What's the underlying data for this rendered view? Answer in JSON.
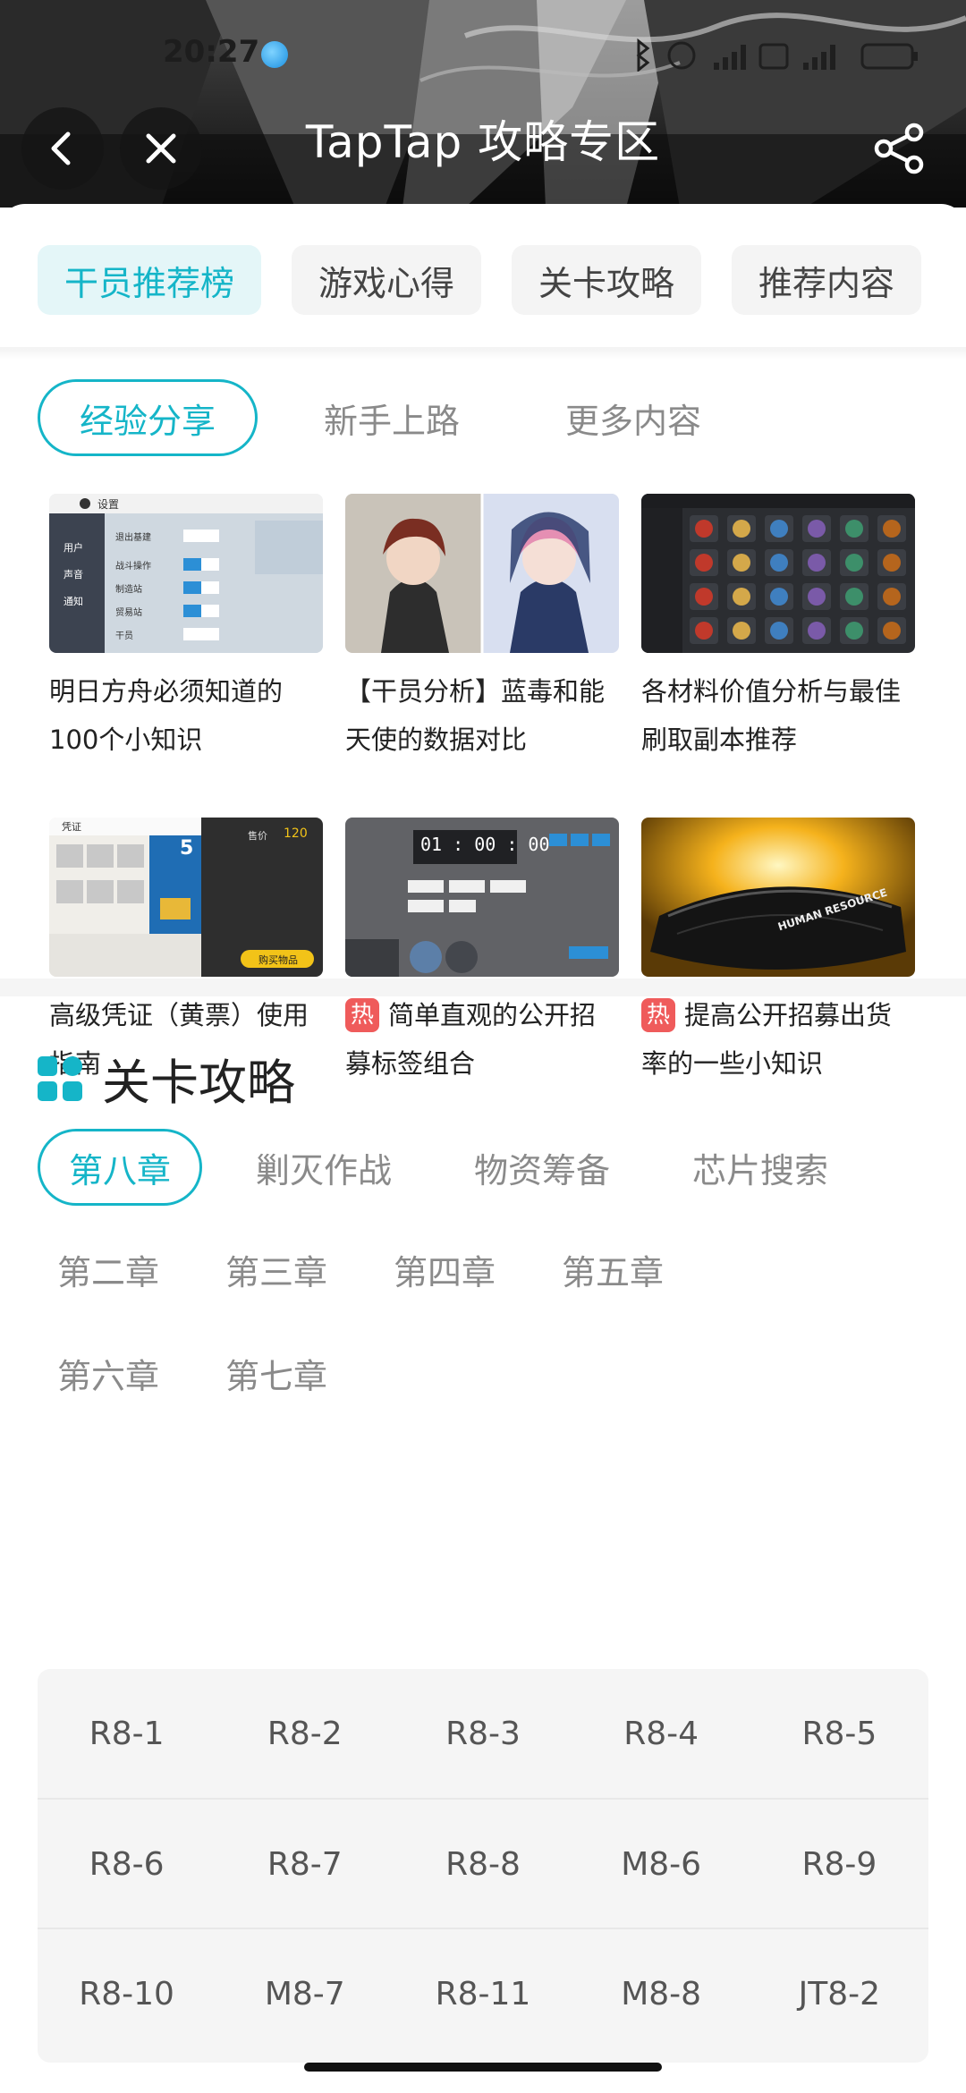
{
  "status_bar": {
    "time": "20:27"
  },
  "header": {
    "title": "TapTap 攻略专区"
  },
  "top_tabs": [
    {
      "label": "干员推荐榜",
      "active": true
    },
    {
      "label": "游戏心得",
      "active": false
    },
    {
      "label": "关卡攻略",
      "active": false
    },
    {
      "label": "推荐内容",
      "active": false
    }
  ],
  "sub_tabs": [
    {
      "label": "经验分享",
      "active": true
    },
    {
      "label": "新手上路",
      "active": false
    },
    {
      "label": "更多内容",
      "active": false
    }
  ],
  "articles": [
    {
      "title": "明日方舟必须知道的100个小知识",
      "hot": false
    },
    {
      "title": "【干员分析】蓝毒和能天使的数据对比",
      "hot": false
    },
    {
      "title": "各材料价值分析与最佳刷取副本推荐",
      "hot": false
    },
    {
      "title": "高级凭证（黄票）使用指南",
      "hot": false
    },
    {
      "title": "简单直观的公开招募标签组合",
      "hot": true
    },
    {
      "title": "提高公开招募出货率的一些小知识",
      "hot": true
    }
  ],
  "hot_label": "热",
  "thumb_text": {
    "settings": "设置",
    "settings_rows": [
      "用户",
      "声音",
      "通知"
    ],
    "settings_items": [
      "退出基建",
      "战斗操作",
      "制造站",
      "贸易站",
      "干员"
    ],
    "shop_title": "凭证",
    "shop_price_label": "售价",
    "shop_price": "120",
    "shop_count": "5",
    "shop_buy": "购买物品",
    "timer": "01 : 00 : 00",
    "banner_text": "HUMAN RESOURCE"
  },
  "section": {
    "title": "关卡攻略"
  },
  "chapter_rows": [
    [
      {
        "label": "第八章",
        "active": true
      },
      {
        "label": "剿灭作战",
        "active": false
      },
      {
        "label": "物资筹备",
        "active": false
      },
      {
        "label": "芯片搜索",
        "active": false
      }
    ],
    [
      {
        "label": "第二章",
        "active": false
      },
      {
        "label": "第三章",
        "active": false
      },
      {
        "label": "第四章",
        "active": false
      },
      {
        "label": "第五章",
        "active": false
      }
    ],
    [
      {
        "label": "第六章",
        "active": false
      },
      {
        "label": "第七章",
        "active": false
      }
    ]
  ],
  "stages": [
    [
      "R8-1",
      "R8-2",
      "R8-3",
      "R8-4",
      "R8-5"
    ],
    [
      "R8-6",
      "R8-7",
      "R8-8",
      "M8-6",
      "R8-9"
    ],
    [
      "R8-10",
      "M8-7",
      "R8-11",
      "M8-8",
      "JT8-2"
    ]
  ],
  "colors": {
    "accent": "#15b5c8",
    "hot": "#ef5b5b",
    "chip_bg": "#f4f4f4",
    "active_chip_bg": "#e4f6f8"
  },
  "icons": [
    "back-arrow-icon",
    "close-icon",
    "share-icon",
    "grid-squares-icon"
  ]
}
